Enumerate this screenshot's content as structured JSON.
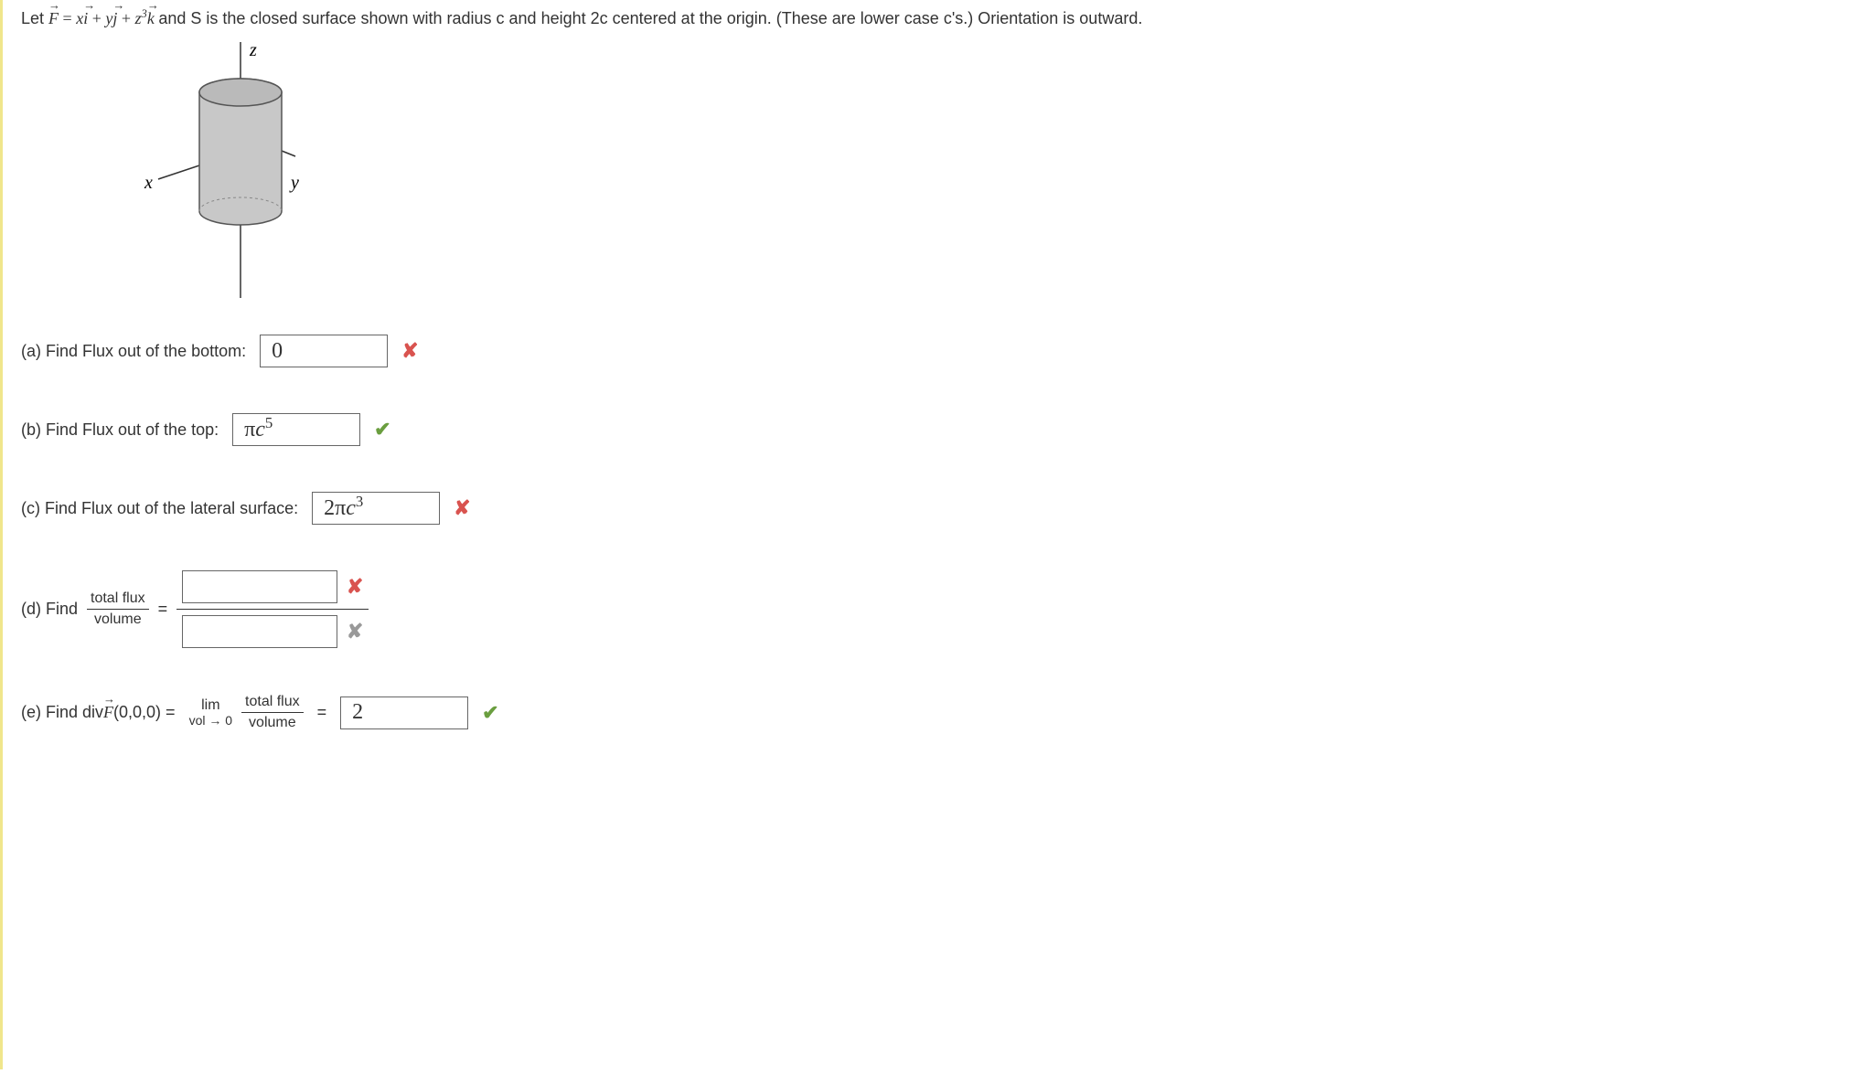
{
  "problem": {
    "prefix": "Let  ",
    "vector_eq_html": "F = x i + y j + z³ k",
    "suffix": "  and S is the closed surface shown with radius c and height 2c centered at the origin. (These are lower case c's.) Orientation is outward."
  },
  "figure": {
    "labels": {
      "z": "z",
      "x": "x",
      "y": "y"
    }
  },
  "parts": {
    "a": {
      "label": "(a) Find Flux out of the bottom:",
      "answer": "0",
      "status": "wrong"
    },
    "b": {
      "label": "(b) Find Flux out of the top:",
      "answer": "πc⁵",
      "status": "correct"
    },
    "c": {
      "label": "(c) Find Flux out of the lateral surface:",
      "answer": "2πc³",
      "status": "wrong"
    },
    "d": {
      "label_prefix": "(d) Find ",
      "frac_num": "total flux",
      "frac_den": "volume",
      "equals": " = ",
      "numerator_answer": "",
      "denominator_answer": "",
      "num_status": "wrong",
      "den_status": "gray"
    },
    "e": {
      "label_prefix": "(e) Find  div",
      "func": "F",
      "point": "(0,0,0) = ",
      "lim_top": "lim",
      "lim_bot": "vol → 0",
      "frac_num": "total flux",
      "frac_den": "volume",
      "equals": " = ",
      "answer": "2",
      "status": "correct"
    }
  },
  "icons": {
    "wrong": "✘",
    "correct": "✔",
    "gray": "✘"
  }
}
